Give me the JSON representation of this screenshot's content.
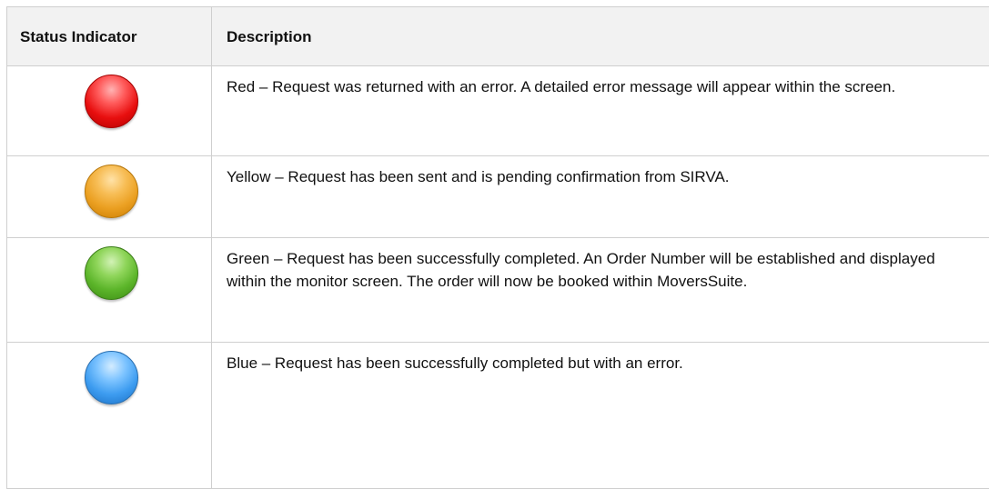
{
  "table": {
    "headers": {
      "status": "Status Indicator",
      "description": "Description"
    },
    "rows": [
      {
        "icon": "red-status-dot-icon",
        "color": "#e81a1a",
        "description": "Red – Request was returned with an error.   A detailed error message will appear within the screen."
      },
      {
        "icon": "yellow-status-dot-icon",
        "color": "#f0a830",
        "description": "Yellow – Request has been sent and is pending confirmation from SIRVA."
      },
      {
        "icon": "green-status-dot-icon",
        "color": "#6cc236",
        "description": "Green – Request has been successfully completed.  An Order Number will be established and displayed within the monitor screen.   The order will now be booked within MoversSuite."
      },
      {
        "icon": "blue-status-dot-icon",
        "color": "#4aa8f5",
        "description": "Blue – Request has been successfully completed but with an error."
      }
    ]
  }
}
